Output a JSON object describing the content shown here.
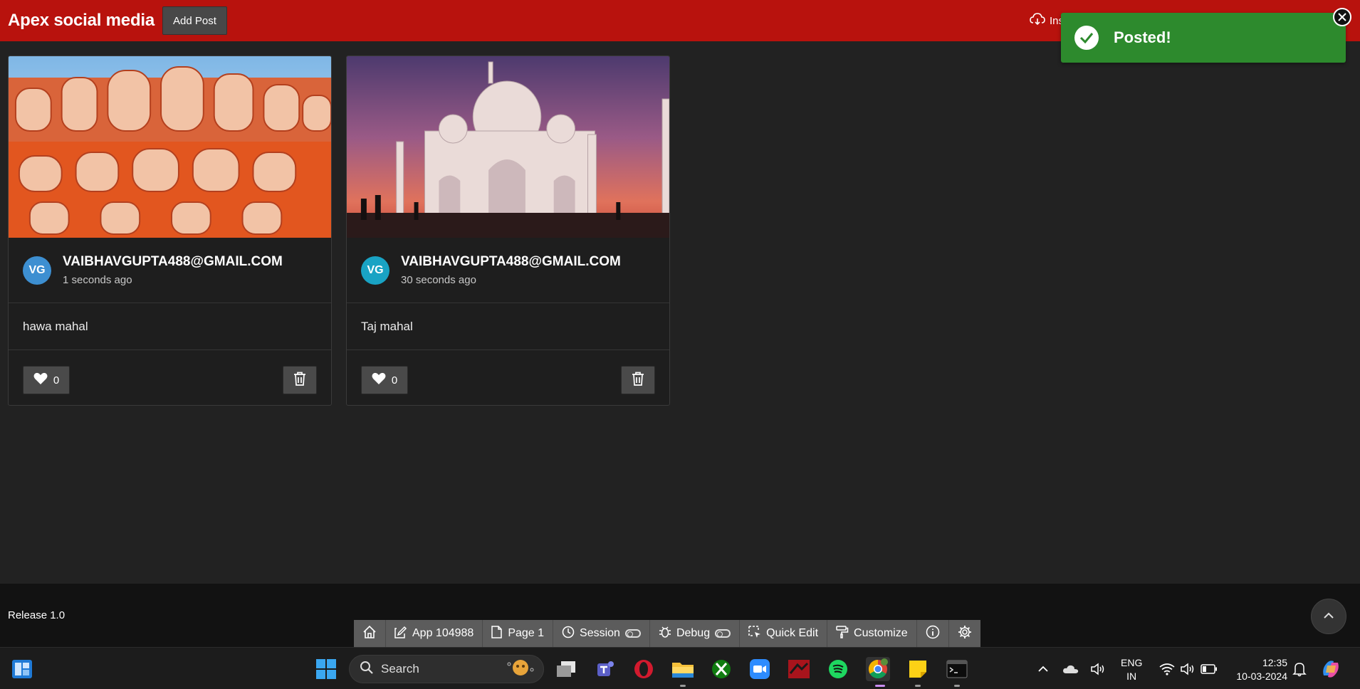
{
  "header": {
    "title": "Apex social media",
    "add_post_label": "Add Post",
    "right_link_label": "Ins"
  },
  "toast": {
    "message": "Posted!"
  },
  "posts": [
    {
      "avatar_initials": "VG",
      "avatar_color": "#3d8fd1",
      "author": "VAIBHAVGUPTA488@GMAIL.COM",
      "time": "1 seconds ago",
      "text": "hawa mahal",
      "likes": "0",
      "image_icon": "hawa-mahal-photo"
    },
    {
      "avatar_initials": "VG",
      "avatar_color": "#19a3c4",
      "author": "VAIBHAVGUPTA488@GMAIL.COM",
      "time": "30 seconds ago",
      "text": "Taj mahal",
      "likes": "0",
      "image_icon": "taj-mahal-photo"
    }
  ],
  "footer": {
    "release": "Release 1.0"
  },
  "devbar": {
    "app": "App 104988",
    "page": "Page 1",
    "session": "Session",
    "debug": "Debug",
    "quick_edit": "Quick Edit",
    "customize": "Customize"
  },
  "taskbar": {
    "search_placeholder": "Search",
    "lang_line1": "ENG",
    "lang_line2": "IN",
    "time": "12:35",
    "date": "10-03-2024"
  },
  "colors": {
    "header": "#b8120d",
    "toast": "#2d8a2d",
    "background": "#222222"
  }
}
